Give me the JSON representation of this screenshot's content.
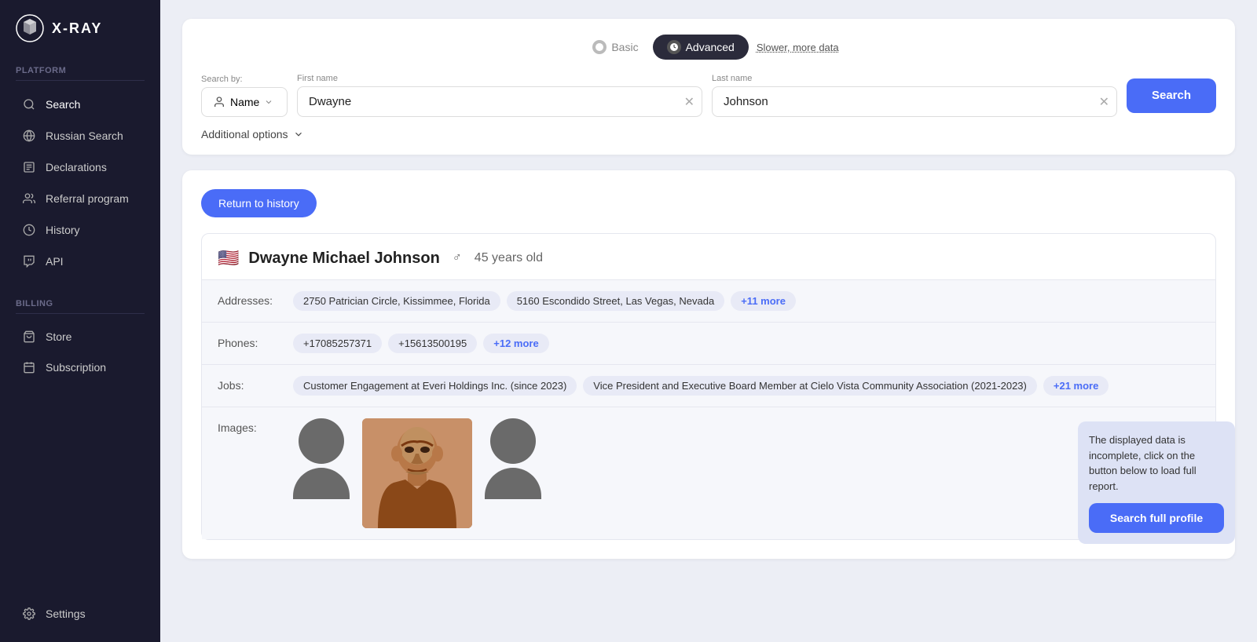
{
  "sidebar": {
    "logo": "X-RAY",
    "sections": [
      {
        "label": "Platform",
        "items": [
          {
            "id": "search",
            "label": "Search",
            "icon": "🔍"
          },
          {
            "id": "russian-search",
            "label": "Russian Search",
            "icon": "🌐"
          },
          {
            "id": "declarations",
            "label": "Declarations",
            "icon": "📋"
          },
          {
            "id": "referral",
            "label": "Referral program",
            "icon": "👥"
          },
          {
            "id": "history",
            "label": "History",
            "icon": "🕐"
          },
          {
            "id": "api",
            "label": "API",
            "icon": "🔑"
          }
        ]
      },
      {
        "label": "Billing",
        "items": [
          {
            "id": "store",
            "label": "Store",
            "icon": "🛒"
          },
          {
            "id": "subscription",
            "label": "Subscription",
            "icon": "📅"
          }
        ]
      }
    ],
    "bottom_items": [
      {
        "id": "settings",
        "label": "Settings",
        "icon": "⚙️"
      }
    ]
  },
  "search": {
    "mode_basic": "Basic",
    "mode_advanced": "Advanced",
    "slower_text": "Slower, more data",
    "search_by_label": "Search by:",
    "search_by_value": "Name",
    "first_name_label": "First name",
    "first_name_value": "Dwayne",
    "last_name_label": "Last name",
    "last_name_value": "Johnson",
    "search_btn": "Search",
    "additional_options": "Additional options"
  },
  "results": {
    "return_btn": "Return to history",
    "person": {
      "name": "Dwayne Michael Johnson",
      "gender": "♂",
      "age": "45 years old",
      "flag": "🇺🇸",
      "addresses_label": "Addresses:",
      "addresses": [
        "2750 Patrician Circle, Kissimmee, Florida",
        "5160 Escondido Street, Las Vegas, Nevada",
        "+11 more"
      ],
      "phones_label": "Phones:",
      "phones": [
        "+17085257371",
        "+15613500195",
        "+12 more"
      ],
      "jobs_label": "Jobs:",
      "jobs": [
        "Customer Engagement at Everi Holdings Inc. (since 2023)",
        "Vice President and Executive Board Member at Cielo Vista Community Association (2021-2023)",
        "+21 more"
      ],
      "images_label": "Images:"
    },
    "tooltip": {
      "text": "The displayed data is incomplete, click on the button below to load full report.",
      "btn": "Search full profile"
    }
  }
}
